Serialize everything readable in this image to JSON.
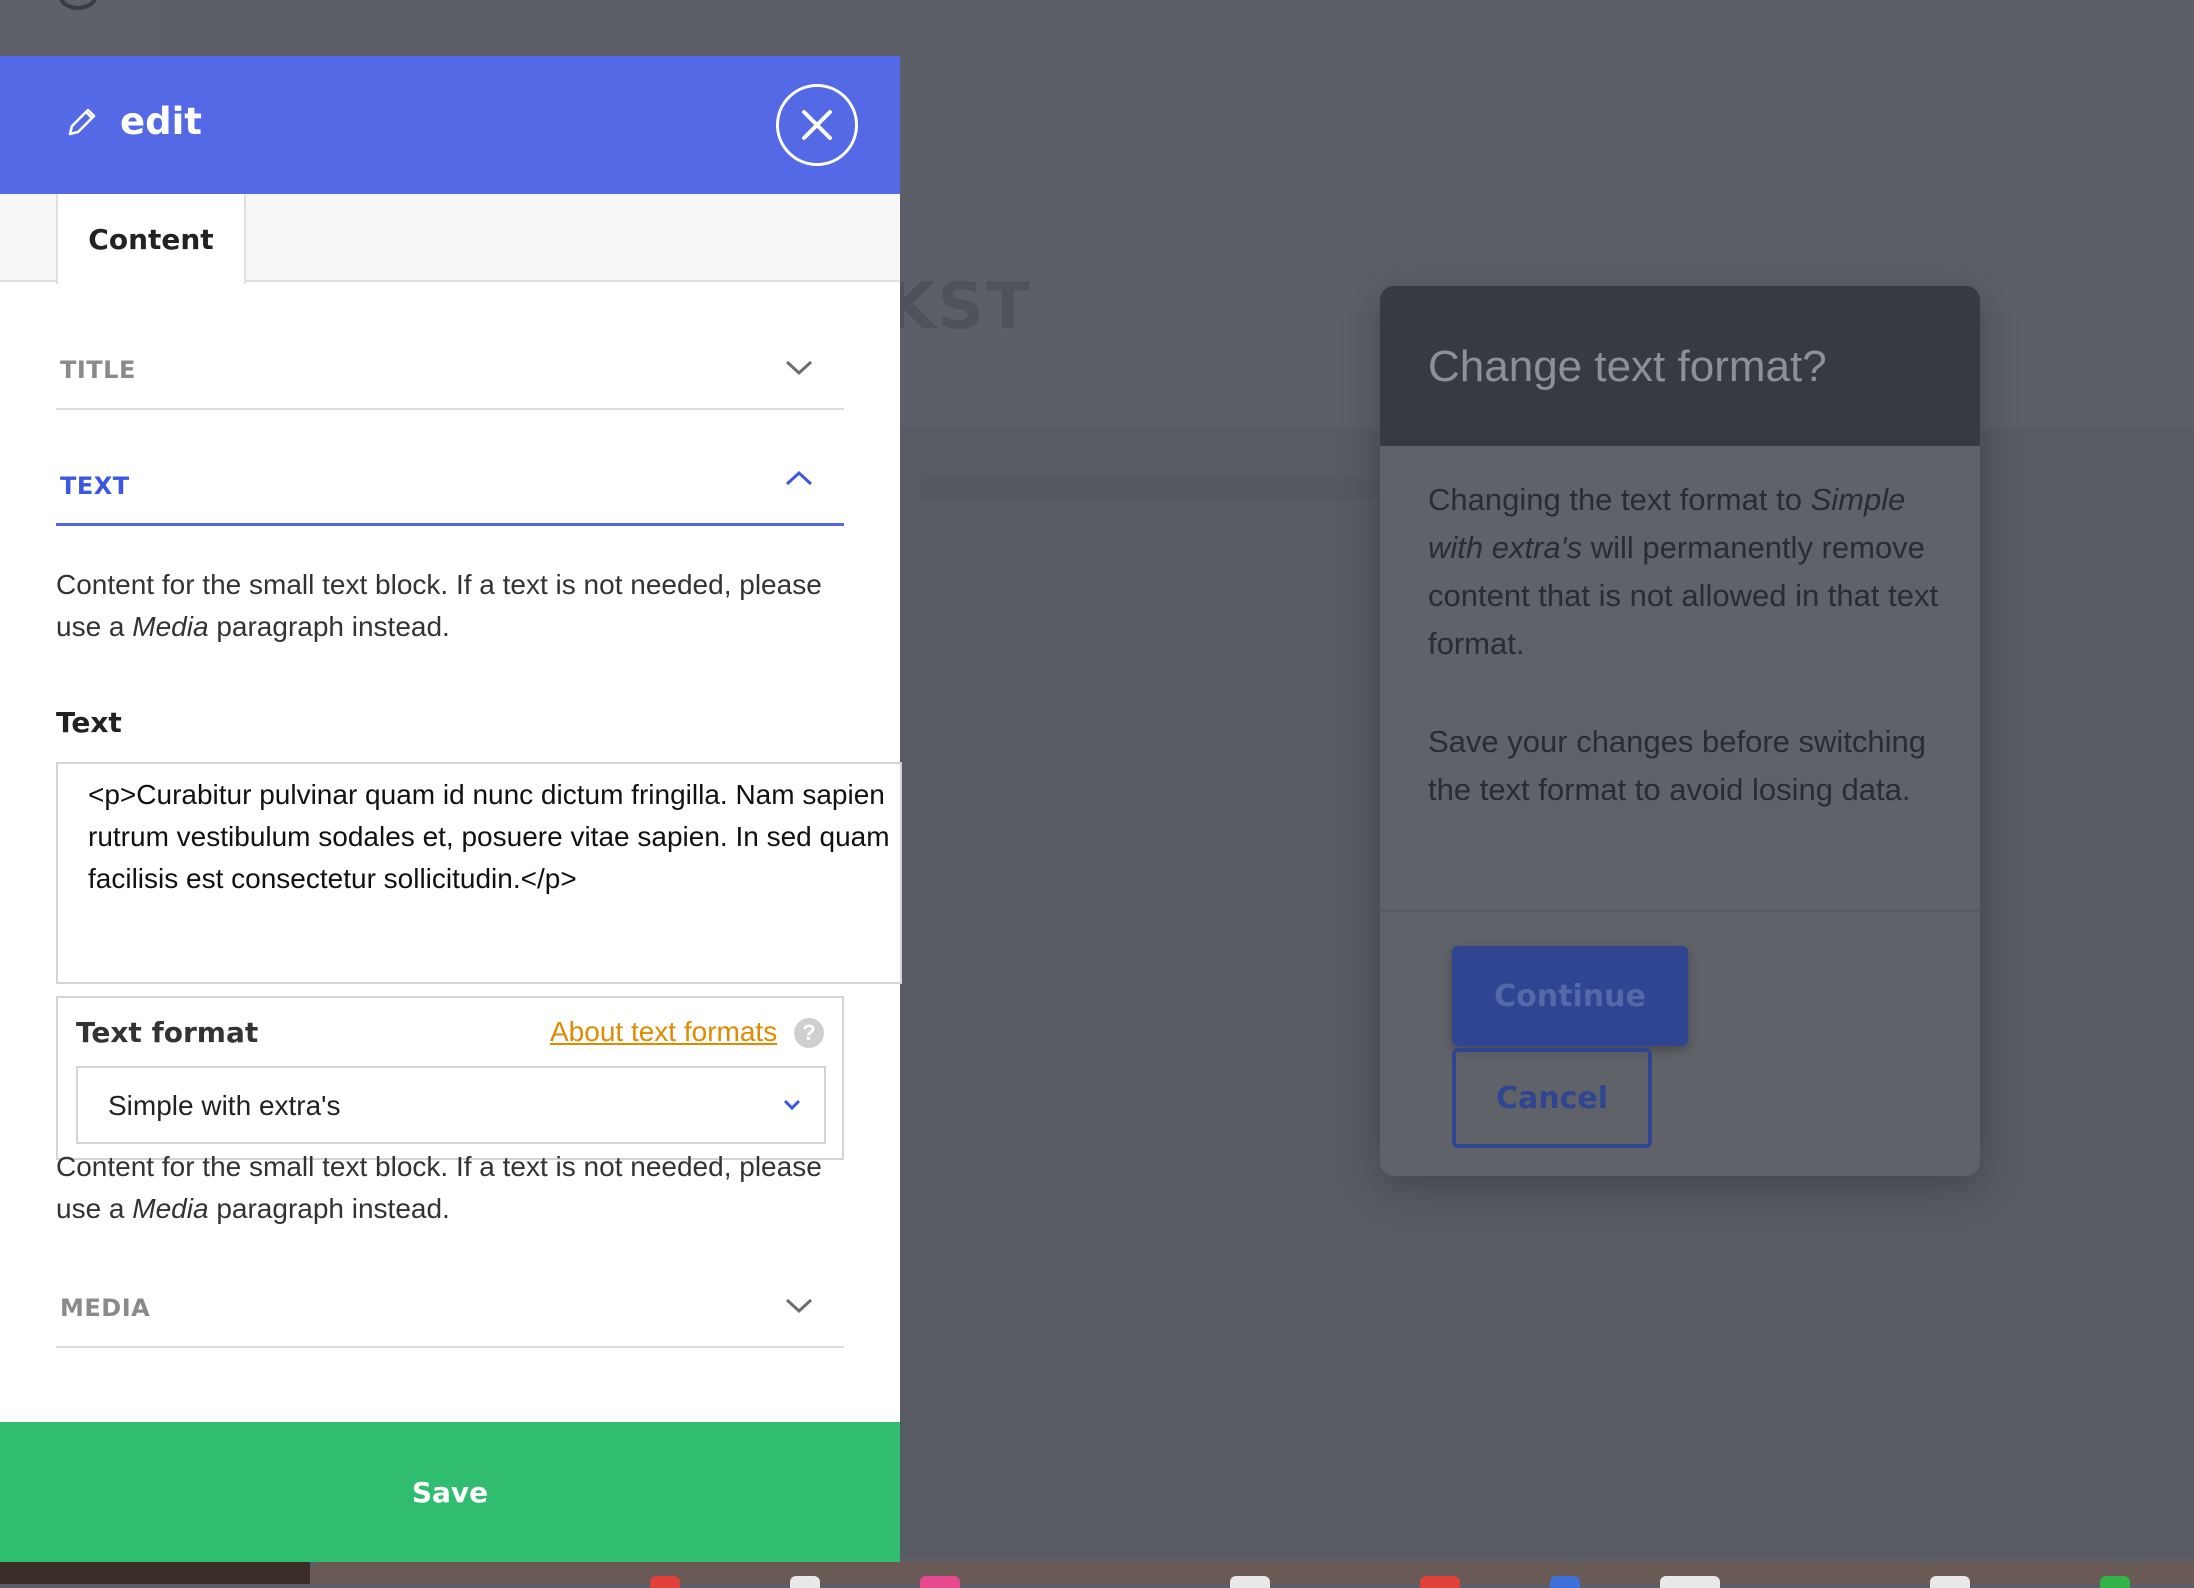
{
  "panel": {
    "title": "edit",
    "tab": "Content",
    "sections": {
      "title_label": "TITLE",
      "text_label": "TEXT",
      "media_label": "MEDIA"
    },
    "description": {
      "before": "Content for the small text block. If a text is not needed, please use a ",
      "italic": "Media",
      "after": " paragraph instead."
    },
    "text_field_label": "Text",
    "text_value": "<p>Curabitur pulvinar quam id nunc dictum fringilla. Nam sapien rutrum vestibulum sodales et, posuere vitae sapien. In sed quam facilisis est consectetur sollicitudin.</p>",
    "text_format": {
      "label": "Text format",
      "link": "About text formats",
      "help": "?",
      "selected": "Simple with extra's"
    },
    "save_label": "Save"
  },
  "background": {
    "heading_fragment": "KST"
  },
  "modal": {
    "title": "Change text format?",
    "body1_before": "Changing the text format to ",
    "body1_italic": "Simple with extra's",
    "body1_after": " will permanently remove content that is not allowed in that text format.",
    "body2": "Save your changes before switching the text format to avoid losing data.",
    "continue_label": "Continue",
    "cancel_label": "Cancel"
  },
  "colors": {
    "header_blue": "#5469e6",
    "save_green": "#30bd6f",
    "link_orange": "#e08a00",
    "modal_button_blue": "#2f4592"
  },
  "icons": [
    "pencil-icon",
    "close-icon",
    "chevron-down-icon",
    "chevron-up-icon",
    "help-icon"
  ]
}
